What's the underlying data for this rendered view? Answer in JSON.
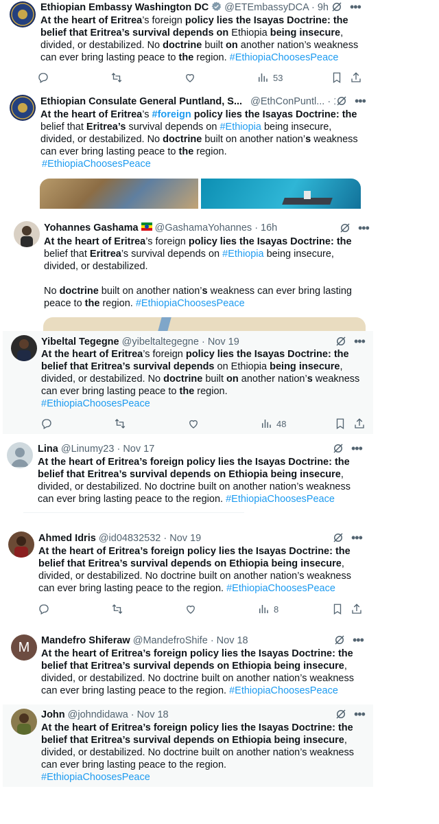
{
  "tweets": [
    {
      "name": "Ethiopian Embassy Washington DC",
      "handle": "@ETEmbassyDCA",
      "time": "9h",
      "segments": [
        {
          "t": "At the heart of Eritrea",
          "b": 1
        },
        {
          "t": "’s foreign ",
          "b": 0
        },
        {
          "t": "policy lies the Isayas Doctrine: the belief",
          "b": 1
        },
        {
          "t": " ",
          "b": 0
        },
        {
          "t": "that Eritrea’s survival depends on",
          "b": 1
        },
        {
          "t": " Ethiopia ",
          "b": 0
        },
        {
          "t": "being insecure",
          "b": 1
        },
        {
          "t": ", divided, or destabilized. No ",
          "b": 0
        },
        {
          "t": "doctrine",
          "b": 1
        },
        {
          "t": " built ",
          "b": 0
        },
        {
          "t": "on",
          "b": 1
        },
        {
          "t": " another nation’s weakness can ever bring lasting peace to ",
          "b": 0
        },
        {
          "t": "the",
          "b": 1
        },
        {
          "t": " region. ",
          "b": 0
        },
        {
          "t": "#EthiopiaChoosesPeace",
          "b": 0,
          "h": 1
        }
      ],
      "views": "53"
    },
    {
      "name": "Ethiopian Consulate General Puntland, S...",
      "handle": "@EthConPuntl...",
      "time": "16h",
      "segments": [
        {
          "t": "At the heart of Eritrea",
          "b": 1
        },
        {
          "t": "’s ",
          "b": 0
        },
        {
          "t": "#foreign",
          "b": 1,
          "h": 1
        },
        {
          "t": " ",
          "b": 0
        },
        {
          "t": "policy lies the Isayas Doctrine: the",
          "b": 1
        },
        {
          "t": " belief that ",
          "b": 0
        },
        {
          "t": "Eritrea’s",
          "b": 1
        },
        {
          "t": " survival depends on ",
          "b": 0
        },
        {
          "t": "#Ethiopia",
          "b": 0,
          "h": 1
        },
        {
          "t": " being insecure, divided, or destabilized. No ",
          "b": 0
        },
        {
          "t": "doctrine",
          "b": 1
        },
        {
          "t": " built on another nation’",
          "b": 0
        },
        {
          "t": "s",
          "b": 1
        },
        {
          "t": " weakness can ever bring lasting peace to ",
          "b": 0
        },
        {
          "t": "the",
          "b": 1
        },
        {
          "t": " region.",
          "b": 0
        }
      ],
      "hashtag_line": "#EthiopiaChoosesPeace"
    },
    {
      "name": "Yohannes Gashama",
      "handle": "@GashamaYohannes",
      "time": "16h",
      "segments": [
        {
          "t": "At the heart of Eritrea",
          "b": 1
        },
        {
          "t": "’s foreign ",
          "b": 0
        },
        {
          "t": "policy lies the Isayas Doctrine: the",
          "b": 1
        },
        {
          "t": " belief that ",
          "b": 0
        },
        {
          "t": "Eritrea",
          "b": 1
        },
        {
          "t": "’s survival depends on ",
          "b": 0
        },
        {
          "t": "#Ethiopia",
          "b": 0,
          "h": 1
        },
        {
          "t": " being insecure, divided, or destabilized.",
          "b": 0
        }
      ],
      "segments2": [
        {
          "t": "No ",
          "b": 0
        },
        {
          "t": "doctrine",
          "b": 1
        },
        {
          "t": " built on another nation’",
          "b": 0
        },
        {
          "t": "s",
          "b": 1
        },
        {
          "t": " weakness can ever bring lasting peace to ",
          "b": 0
        },
        {
          "t": "the",
          "b": 1
        },
        {
          "t": " region. ",
          "b": 0
        },
        {
          "t": "#EthiopiaChoosesPeace",
          "b": 0,
          "h": 1
        }
      ]
    },
    {
      "name": "Yibeltal Tegegne",
      "handle": "@yibeltaltegegne",
      "time": "Nov 19",
      "segments": [
        {
          "t": "At the heart of Eritrea",
          "b": 1
        },
        {
          "t": "’s foreign ",
          "b": 0
        },
        {
          "t": "policy lies the Isayas Doctrine: the belief that Eritrea’s survival depends",
          "b": 1
        },
        {
          "t": " on Ethiopia ",
          "b": 0
        },
        {
          "t": "being insecure",
          "b": 1
        },
        {
          "t": ", divided, or destabilized. No ",
          "b": 0
        },
        {
          "t": "doctrine",
          "b": 1
        },
        {
          "t": " built ",
          "b": 0
        },
        {
          "t": "on",
          "b": 1
        },
        {
          "t": " another nation’",
          "b": 0
        },
        {
          "t": "s",
          "b": 1
        },
        {
          "t": " weakness can ever bring lasting peace to ",
          "b": 0
        },
        {
          "t": "the",
          "b": 1
        },
        {
          "t": " region.",
          "b": 0
        }
      ],
      "hashtag_line": "#EthiopiaChoosesPeace",
      "views": "48"
    },
    {
      "name": "Lina",
      "handle": "@Linumy23",
      "time": "Nov 17",
      "segments": [
        {
          "t": "At the heart of Eritrea’s foreign policy lies the Isayas Doctrine: the belief that Eritrea’s survival depends on Ethiopia being insecure",
          "b": 1
        },
        {
          "t": ", divided, or destabilized. No doctrine built on another nation’s weakness can ever bring lasting peace to the region. ",
          "b": 0
        },
        {
          "t": "#EthiopiaChoosesPeace",
          "b": 0,
          "h": 1
        }
      ]
    },
    {
      "name": "Ahmed Idris",
      "handle": "@id04832532",
      "time": "Nov 19",
      "segments": [
        {
          "t": "At the heart of Eritrea’s foreign policy lies the Isayas Doctrine: the belief that Eritrea’s survival depends on Ethiopia being insecure",
          "b": 1
        },
        {
          "t": ", divided, or destabilized. No doctrine built on another nation’s weakness can ever bring lasting peace to the region. ",
          "b": 0
        },
        {
          "t": "#EthiopiaChoosesPeace",
          "b": 0,
          "h": 1
        }
      ],
      "views": "8"
    },
    {
      "name": "Mandefro Shiferaw",
      "handle": "@MandefroShife",
      "time": "Nov 18",
      "avatar_letter": "M",
      "segments": [
        {
          "t": "At the heart of Eritrea’s foreign policy lies the Isayas Doctrine: the belief that Eritrea’s survival depends on Ethiopia being insecure",
          "b": 1
        },
        {
          "t": ", divided, or destabilized. No doctrine built on another nation’s weakness can ever bring lasting peace to the region.  ",
          "b": 0
        },
        {
          "t": "#EthiopiaChoosesPeace",
          "b": 0,
          "h": 1
        }
      ]
    },
    {
      "name": "John",
      "handle": "@johndidawa",
      "time": "Nov 18",
      "segments": [
        {
          "t": "At the heart of Eritrea’s foreign policy lies the Isayas Doctrine: the belief that Eritrea’s survival depends on Ethiopia being insecure",
          "b": 1
        },
        {
          "t": ", divided, or destabilized. No doctrine built on another nation’s weakness can ever bring lasting peace to the region.",
          "b": 0
        }
      ],
      "hashtag_line": "#EthiopiaChoosesPeace"
    }
  ],
  "colors": {
    "link": "#1d9bf0",
    "text": "#0f1419",
    "muted": "#536471",
    "verified": "#829aab",
    "shaded_bg": "#f7f9f9"
  },
  "icons": [
    "reply-icon",
    "retweet-icon",
    "like-icon",
    "views-icon",
    "bookmark-icon",
    "share-icon",
    "grok-icon",
    "more-icon",
    "verified-badge-icon",
    "ethiopia-flag-icon"
  ]
}
